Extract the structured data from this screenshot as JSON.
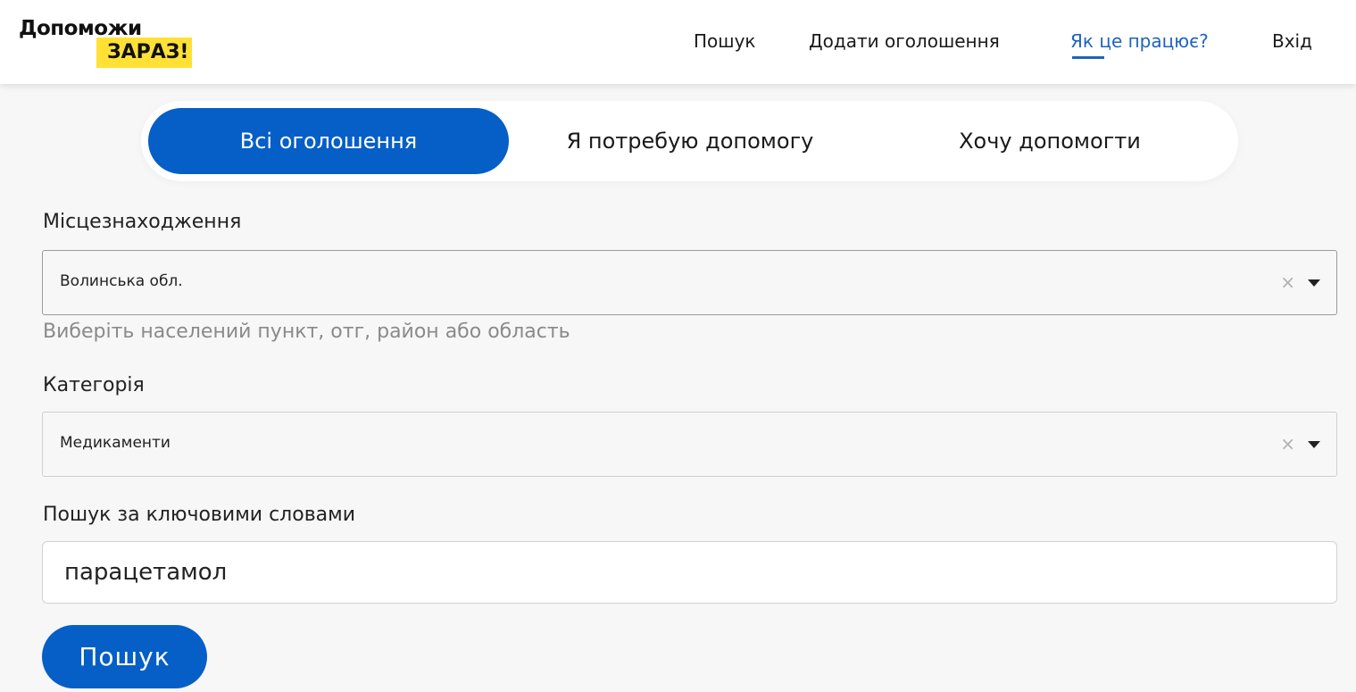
{
  "header": {
    "logo": {
      "line1": "Допоможи",
      "line2": "ЗАРАЗ!"
    },
    "nav": [
      {
        "label": "Пошук",
        "active": false
      },
      {
        "label": "Додати оголошення",
        "active": false
      },
      {
        "label": "Як це працює?",
        "active": true
      },
      {
        "label": "Вхід",
        "active": false
      }
    ]
  },
  "segment": {
    "options": [
      {
        "label": "Всі оголошення",
        "active": true
      },
      {
        "label": "Я потребую допомогу",
        "active": false
      },
      {
        "label": "Хочу допомогти",
        "active": false
      }
    ]
  },
  "form": {
    "location": {
      "label": "Місцезнаходження",
      "value": "Волинська обл.",
      "help": "Виберіть населений пункт, отг, район або область",
      "clear_glyph": "×"
    },
    "category": {
      "label": "Категорія",
      "value": "Медикаменти",
      "clear_glyph": "×"
    },
    "keywords": {
      "label": "Пошук за ключовими словами",
      "value": "парацетамол"
    },
    "submit_label": "Пошук"
  },
  "colors": {
    "accent": "#055fc6",
    "link_active": "#1e63c0",
    "logo_highlight": "#ffe135",
    "page_bg": "#f7f7f7"
  }
}
